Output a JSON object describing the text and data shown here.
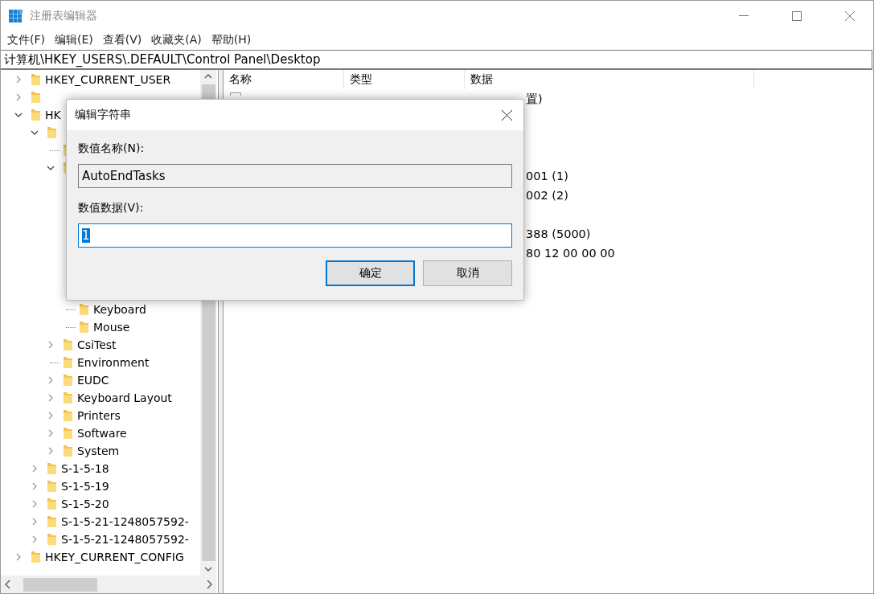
{
  "window": {
    "title": "注册表编辑器"
  },
  "menu": [
    "文件(F)",
    "编辑(E)",
    "查看(V)",
    "收藏夹(A)",
    "帮助(H)"
  ],
  "address": "计算机\\HKEY_USERS\\.DEFAULT\\Control Panel\\Desktop",
  "tree": [
    {
      "kind": "branch",
      "label": "HKEY_CURRENT_USER",
      "expanded": false
    },
    {
      "kind": "branch",
      "expanded": false
    },
    {
      "kind": "branch",
      "label": "HK",
      "expanded": true,
      "children": [
        {
          "kind": "branch",
          "expanded": true,
          "children": [
            {
              "kind": "leaf"
            },
            {
              "kind": "branch",
              "expanded": true,
              "children": [
                {
                  "kind": "leaf",
                  "label": "Keyboard"
                },
                {
                  "kind": "leaf",
                  "label": "Mouse"
                }
              ]
            },
            {
              "kind": "branch",
              "label": "CsiTest",
              "expanded": false
            },
            {
              "kind": "leaf",
              "label": "Environment"
            },
            {
              "kind": "branch",
              "label": "EUDC",
              "expanded": false
            },
            {
              "kind": "branch",
              "label": "Keyboard Layout",
              "expanded": false
            },
            {
              "kind": "branch",
              "label": "Printers",
              "expanded": false
            },
            {
              "kind": "branch",
              "label": "Software",
              "expanded": false
            },
            {
              "kind": "branch",
              "label": "System",
              "expanded": false
            }
          ]
        },
        {
          "kind": "branch",
          "label": "S-1-5-18",
          "expanded": false
        },
        {
          "kind": "branch",
          "label": "S-1-5-19",
          "expanded": false
        },
        {
          "kind": "branch",
          "label": "S-1-5-20",
          "expanded": false
        },
        {
          "kind": "branch",
          "label": "S-1-5-21-1248057592-",
          "expanded": false
        },
        {
          "kind": "branch",
          "label": "S-1-5-21-1248057592-",
          "expanded": false
        }
      ]
    },
    {
      "kind": "branch",
      "label": "HKEY_CURRENT_CONFIG",
      "expanded": false
    }
  ],
  "list": {
    "columns": [
      "名称",
      "类型",
      "数据"
    ],
    "rows": [
      {
        "data": "置)"
      },
      {},
      {},
      {},
      {
        "data": "001 (1)"
      },
      {
        "data": "002 (2)"
      },
      {},
      {
        "data": "388 (5000)"
      },
      {
        "data": "80 12 00 00 00"
      }
    ]
  },
  "dialog": {
    "title": "编辑字符串",
    "name_label": "数值名称(N):",
    "name_value": "AutoEndTasks",
    "data_label": "数值数据(V):",
    "data_value": "1",
    "value_selected": true,
    "buttons": [
      {
        "label": "确定",
        "default": true
      },
      {
        "label": "取消",
        "default": false
      }
    ]
  }
}
